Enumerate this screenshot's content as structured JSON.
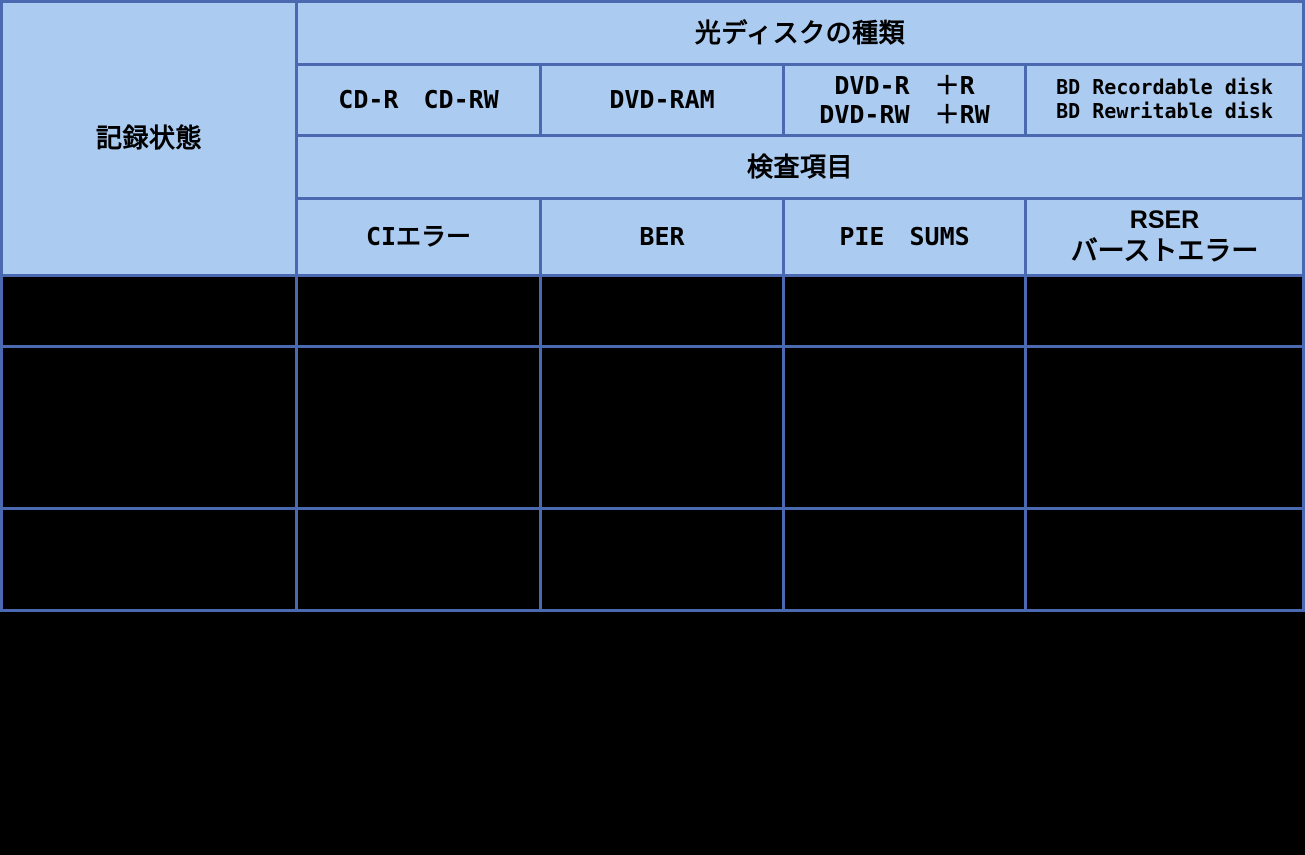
{
  "table": {
    "corner_label": "記録状態",
    "group_row": {
      "disc_types_label": "光ディスクの種類"
    },
    "disc_type_columns": [
      {
        "line1": "CD-R　CD-RW",
        "line2": ""
      },
      {
        "line1": "DVD-RAM",
        "line2": ""
      },
      {
        "line1": "DVD-R　＋R",
        "line2": "DVD-RW　＋RW"
      },
      {
        "line1": "BD Recordable disk",
        "line2": "BD Rewritable disk"
      }
    ],
    "inspection_row": {
      "inspection_items_label": "検査項目"
    },
    "inspection_item_columns": [
      {
        "line1": "CIエラー",
        "line2": ""
      },
      {
        "line1": "BER",
        "line2": ""
      },
      {
        "line1": "PIE　SUMS",
        "line2": ""
      },
      {
        "line1": "RSER",
        "line2": "バーストエラー"
      }
    ],
    "body_rows": [
      {
        "cells": [
          "",
          "",
          "",
          "",
          ""
        ]
      },
      {
        "cells": [
          "",
          "",
          "",
          "",
          ""
        ]
      },
      {
        "cells": [
          "",
          "",
          "",
          "",
          ""
        ]
      }
    ]
  },
  "colors": {
    "header_fill": "#abcbf0",
    "border": "#4a69b0",
    "body_fill": "#000000",
    "text": "#000000",
    "page_background": "#000000"
  }
}
